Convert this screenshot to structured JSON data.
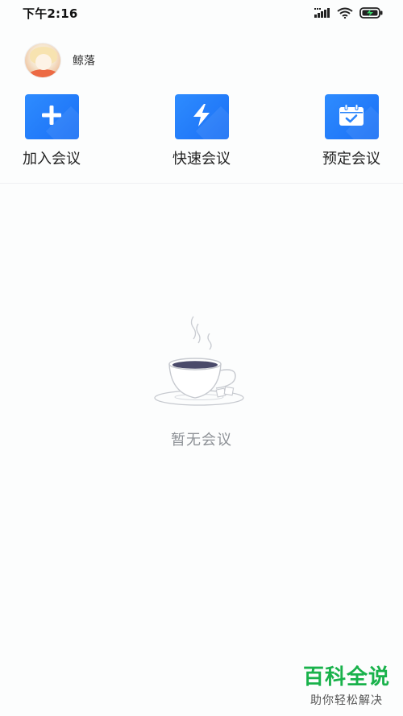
{
  "status_bar": {
    "time": "下午2:16",
    "icons": [
      "signal-icon",
      "wifi-icon",
      "battery-charging-icon"
    ]
  },
  "profile": {
    "username": "鲸落"
  },
  "actions": [
    {
      "label": "加入会议",
      "icon": "plus-icon"
    },
    {
      "label": "快速会议",
      "icon": "lightning-icon"
    },
    {
      "label": "预定会议",
      "icon": "calendar-check-icon"
    }
  ],
  "empty_state": {
    "icon": "coffee-cup-icon",
    "text": "暂无会议"
  },
  "watermark": {
    "title": "百科全说",
    "subtitle": "助你轻松解决"
  },
  "colors": {
    "accent": "#1f7bfa",
    "empty_text": "#8d9196",
    "watermark_green": "#19b24b"
  }
}
